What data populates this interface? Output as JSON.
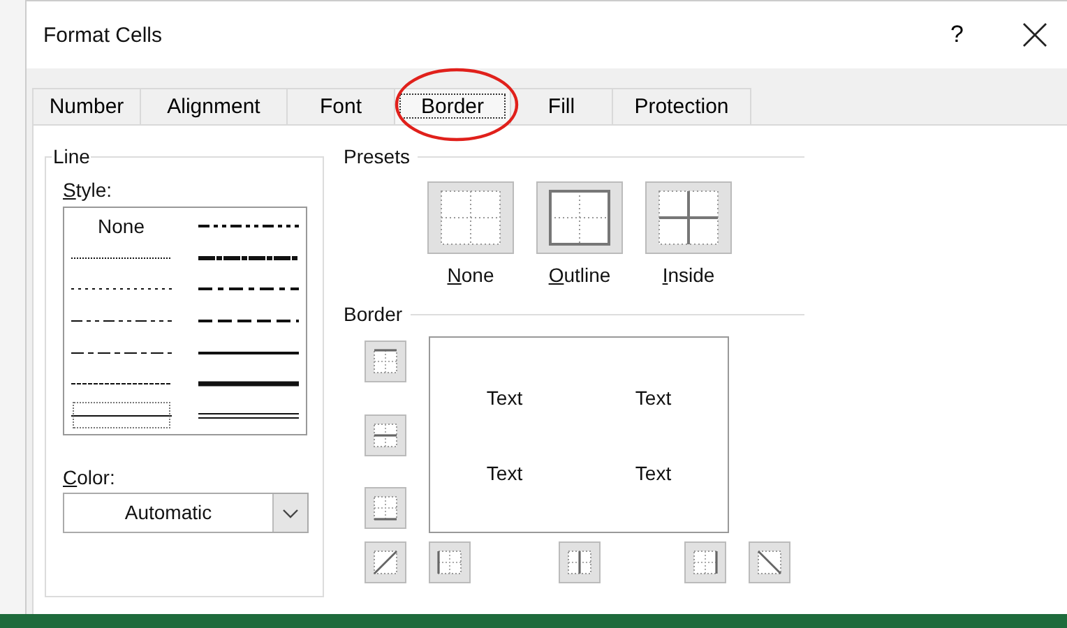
{
  "window": {
    "title": "Format Cells",
    "help": "?"
  },
  "tabs": [
    {
      "label": "Number",
      "selected": false
    },
    {
      "label": "Alignment",
      "selected": false
    },
    {
      "label": "Font",
      "selected": false
    },
    {
      "label": "Border",
      "selected": true
    },
    {
      "label": "Fill",
      "selected": false
    },
    {
      "label": "Protection",
      "selected": false
    }
  ],
  "line": {
    "title": "Line",
    "style_label": "Style:",
    "styles": [
      {
        "kind": "none",
        "label": "None",
        "selected": false
      },
      {
        "kind": "hair",
        "selected": false
      },
      {
        "kind": "dotted",
        "selected": false
      },
      {
        "kind": "dash-dot-dot",
        "selected": false
      },
      {
        "kind": "dash-dot",
        "selected": false
      },
      {
        "kind": "dashed",
        "selected": false
      },
      {
        "kind": "thin",
        "selected": true
      },
      {
        "kind": "medium-dash-dot-dot",
        "selected": false
      },
      {
        "kind": "slant-dash-dot",
        "selected": false
      },
      {
        "kind": "medium-dash-dot",
        "selected": false
      },
      {
        "kind": "medium-dashed",
        "selected": false
      },
      {
        "kind": "medium",
        "selected": false
      },
      {
        "kind": "thick",
        "selected": false
      },
      {
        "kind": "double",
        "selected": false
      }
    ],
    "color_label": "Color:",
    "color_value": "Automatic"
  },
  "presets": {
    "title": "Presets",
    "items": [
      {
        "kind": "none",
        "label": "None"
      },
      {
        "kind": "outline",
        "label": "Outline"
      },
      {
        "kind": "inside",
        "label": "Inside"
      }
    ]
  },
  "border": {
    "title": "Border",
    "preview_texts": [
      "Text",
      "Text",
      "Text",
      "Text"
    ],
    "side_buttons": [
      {
        "kind": "top"
      },
      {
        "kind": "middle"
      },
      {
        "kind": "bottom"
      }
    ],
    "bottom_buttons": [
      {
        "kind": "diag-up"
      },
      {
        "kind": "left"
      },
      {
        "kind": "center"
      },
      {
        "kind": "right"
      },
      {
        "kind": "diag-down"
      }
    ]
  },
  "annotation": {
    "kind": "ellipse"
  }
}
